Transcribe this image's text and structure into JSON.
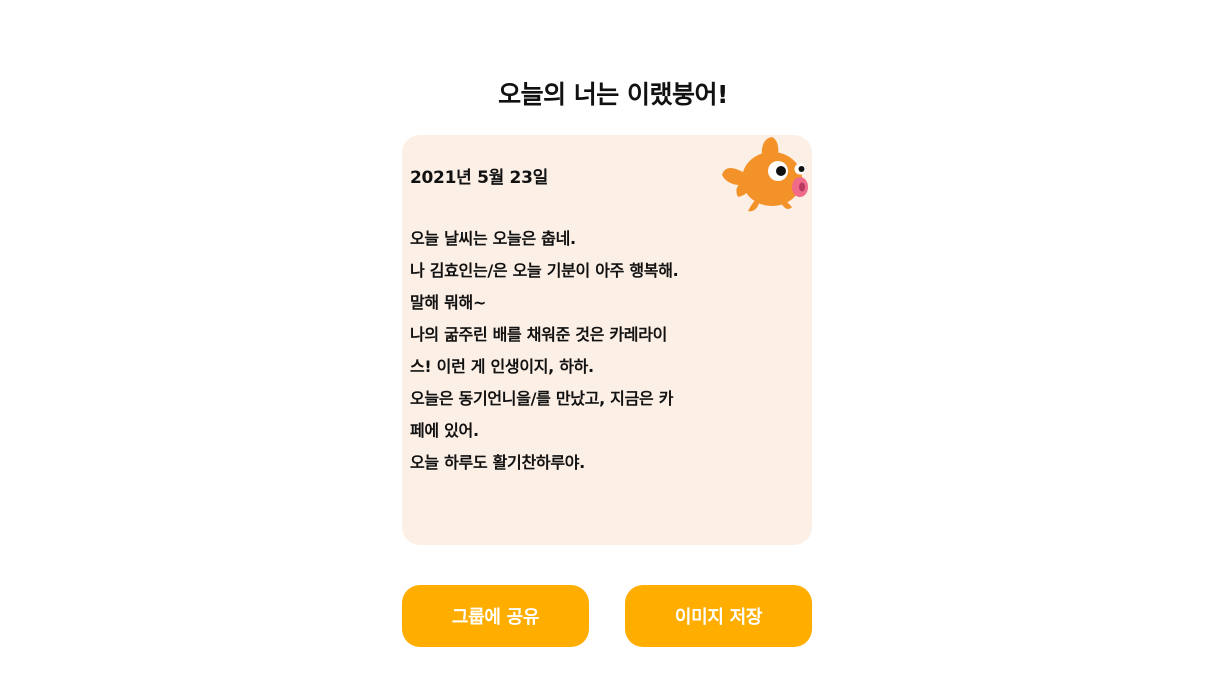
{
  "header": {
    "title": "오늘의 너는 이랬붕어!"
  },
  "diary": {
    "date": "2021년 5월 23일",
    "lines": [
      "오늘 날씨는 오늘은 춥네.",
      "나 김효인는/은 오늘 기분이 아주 행복해.",
      "말해 뭐해~",
      "나의 굶주린 배를 채워준 것은 카레라이",
      "스! 이런 게 인생이지, 하하.",
      "오늘은 동기언니을/를 만났고, 지금은 카",
      "페에 있어.",
      "오늘 하루도 활기찬하루야."
    ],
    "mascot_icon": "goldfish-mascot-icon"
  },
  "actions": {
    "share_label": "그룹에 공유",
    "save_label": "이미지 저장"
  },
  "colors": {
    "card_background": "#fcefe6",
    "button_background": "#ffae00",
    "button_text": "#ffffff",
    "fish_body": "#f4922a",
    "fish_lips": "#f06a8a"
  }
}
